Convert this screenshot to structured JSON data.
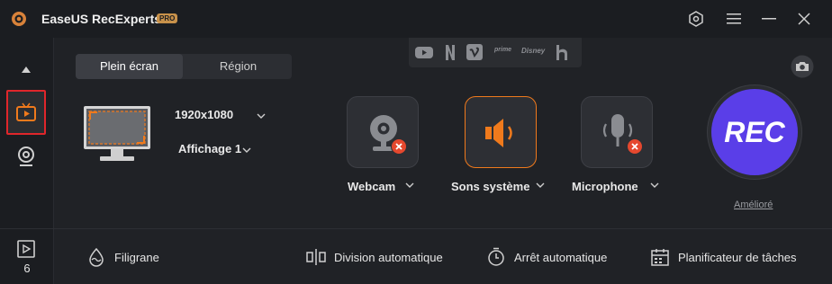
{
  "app": {
    "title": "EaseUS RecExperts",
    "badge": "PRO"
  },
  "mode_tabs": {
    "full_screen": "Plein écran",
    "region": "Région"
  },
  "display": {
    "resolution": "1920x1080",
    "monitor": "Affichage 1"
  },
  "sources": {
    "webcam": "Webcam",
    "system_sound": "Sons système",
    "microphone": "Microphone"
  },
  "rec": {
    "label": "REC",
    "mode": "Amélioré"
  },
  "recordings_count": "6",
  "bottom_bar": {
    "watermark": "Filigrane",
    "auto_split": "Division automatique",
    "auto_stop": "Arrêt automatique",
    "scheduler": "Planificateur de tâches"
  },
  "streaming_icons": [
    "youtube-icon",
    "netflix-icon",
    "vimeo-icon",
    "prime-icon",
    "disney-icon",
    "hulu-icon"
  ],
  "colors": {
    "accent_orange": "#f07a1c",
    "rec_purple": "#5a3ee8",
    "selected_border": "#e0262b",
    "error_red": "#e5482e"
  }
}
